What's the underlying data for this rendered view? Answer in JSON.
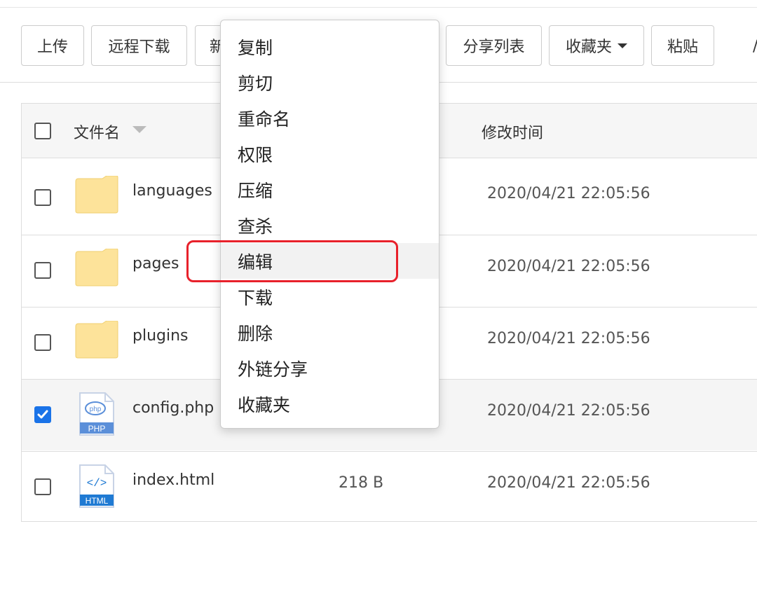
{
  "toolbar": {
    "upload_label": "上传",
    "remote_download_label": "远程下载",
    "new_label_clipped": "新",
    "share_list_label": "分享列表",
    "favorites_label": "收藏夹",
    "paste_label": "粘贴"
  },
  "table": {
    "header": {
      "name_label": "文件名",
      "modified_label": "修改时间"
    },
    "rows": [
      {
        "name": "languages",
        "type": "folder",
        "size": "",
        "modified": "2020/04/21 22:05:56",
        "checked": false
      },
      {
        "name": "pages",
        "type": "folder",
        "size": "",
        "modified": "2020/04/21 22:05:56",
        "checked": false
      },
      {
        "name": "plugins",
        "type": "folder",
        "size": "",
        "modified": "2020/04/21 22:05:56",
        "checked": false
      },
      {
        "name": "config.php",
        "type": "php",
        "icon_label": "PHP",
        "icon_badge": "php",
        "size": "",
        "modified": "2020/04/21 22:05:56",
        "checked": true
      },
      {
        "name": "index.html",
        "type": "html",
        "icon_label": "HTML",
        "icon_badge": "</>",
        "size": "218 B",
        "modified": "2020/04/21 22:05:56",
        "checked": false
      }
    ]
  },
  "context_menu": {
    "items": [
      "复制",
      "剪切",
      "重命名",
      "权限",
      "压缩",
      "查杀",
      "编辑",
      "下载",
      "删除",
      "外链分享",
      "收藏夹"
    ],
    "highlighted_item": "编辑"
  },
  "colors": {
    "highlight_border": "#e8212b",
    "checkbox_checked": "#1a73e8",
    "folder_fill": "#fde39a",
    "php_blue": "#5b8fd9",
    "html_blue": "#1f7ad3"
  }
}
